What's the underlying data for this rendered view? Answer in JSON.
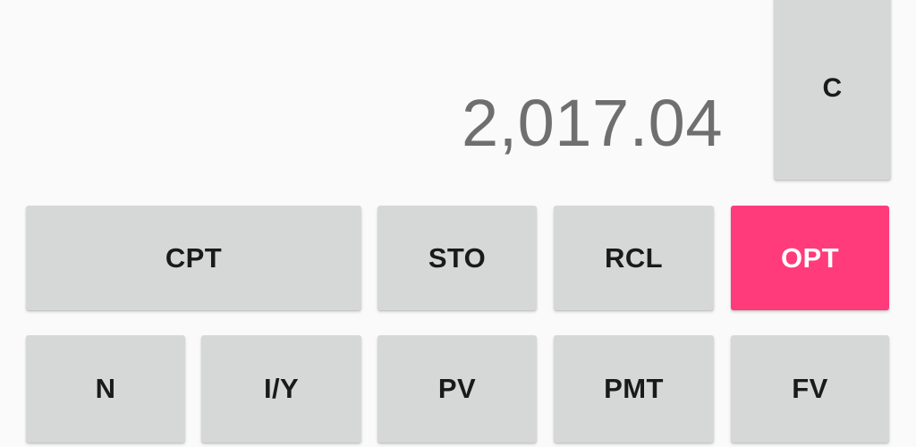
{
  "display": {
    "value": "2,017.04"
  },
  "colors": {
    "accent": "#ff3b7b",
    "key_background": "#d6d7d7",
    "display_text": "#6f6f6f",
    "screen_background": "#fafafa"
  },
  "keys": {
    "clear": "C",
    "compute": "CPT",
    "store": "STO",
    "recall": "RCL",
    "options": "OPT",
    "periods": "N",
    "interest": "I/Y",
    "present_value": "PV",
    "payment": "PMT",
    "future_value": "FV"
  }
}
